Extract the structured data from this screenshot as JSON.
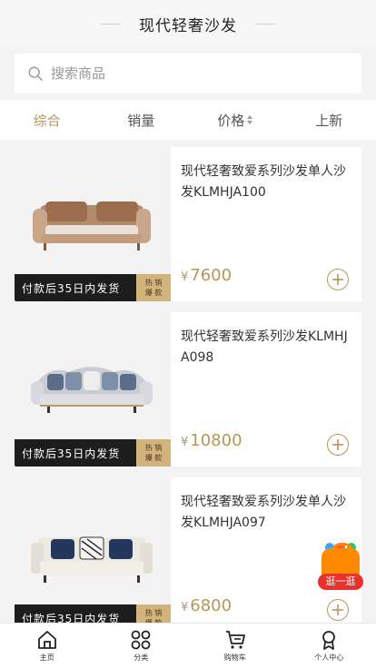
{
  "header": {
    "title": "现代轻奢沙发"
  },
  "search": {
    "placeholder": "搜索商品"
  },
  "sort": {
    "items": [
      {
        "label": "综合",
        "active": true
      },
      {
        "label": "销量",
        "active": false
      },
      {
        "label": "价格",
        "active": false
      },
      {
        "label": "上新",
        "active": false
      }
    ]
  },
  "products": [
    {
      "name": "现代轻奢致爱系列沙发单人沙发KLMHJA100",
      "currency": "¥",
      "price": "7600",
      "banner": "付款后35日内发货",
      "hot_line1": "热 销",
      "hot_line2": "爆 款"
    },
    {
      "name": "现代轻奢致爱系列沙发KLMHJA098",
      "currency": "¥",
      "price": "10800",
      "banner": "付款后35日内发货",
      "hot_line1": "热 销",
      "hot_line2": "爆 款"
    },
    {
      "name": "现代轻奢致爱系列沙发单人沙发KLMHJA097",
      "currency": "¥",
      "price": "6800",
      "banner": "付款后35日内发货",
      "hot_line1": "热 销",
      "hot_line2": "爆 款"
    }
  ],
  "float_badge": {
    "label": "逛一逛"
  },
  "tabbar": {
    "items": [
      {
        "label": "主页",
        "icon": "home-icon"
      },
      {
        "label": "分类",
        "icon": "category-icon"
      },
      {
        "label": "购物车",
        "icon": "cart-icon"
      },
      {
        "label": "个人中心",
        "icon": "profile-icon"
      }
    ]
  },
  "colors": {
    "accent": "#b8955a",
    "banner": "#1d1d1d",
    "hot": "#d2b37b"
  }
}
